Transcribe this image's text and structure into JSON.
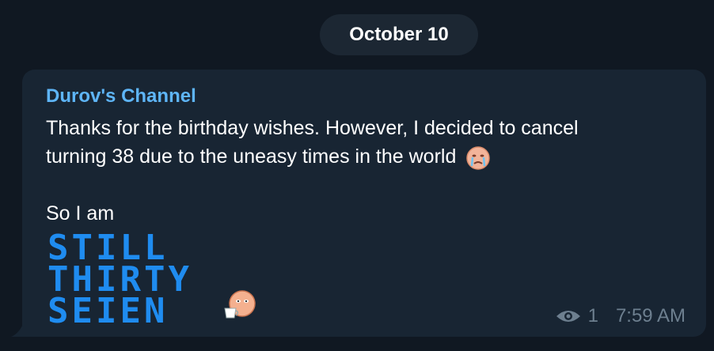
{
  "date_divider": "October 10",
  "post": {
    "channel_name": "Durov's Channel",
    "text_line1": "Thanks for the birthday wishes. However, I decided to cancel",
    "text_line2": "turning 38 due to the uneasy times in the world",
    "text_line3": "So I am",
    "sticker_lines": [
      "STILL",
      "THIRTY",
      "SEIEN"
    ],
    "views": "1",
    "time": "7:59 AM"
  },
  "icons": {
    "eye": "eye-icon",
    "crying_emoji": "crying-face-emoji",
    "coffee_emoji": "coffee-face-emoji"
  },
  "colors": {
    "background": "#101822",
    "bubble": "#182533",
    "pill": "#1c2733",
    "channel_name": "#5eb5f7",
    "text": "#ffffff",
    "sticker_text": "#1f8cf0",
    "meta": "#6d7f8f"
  }
}
